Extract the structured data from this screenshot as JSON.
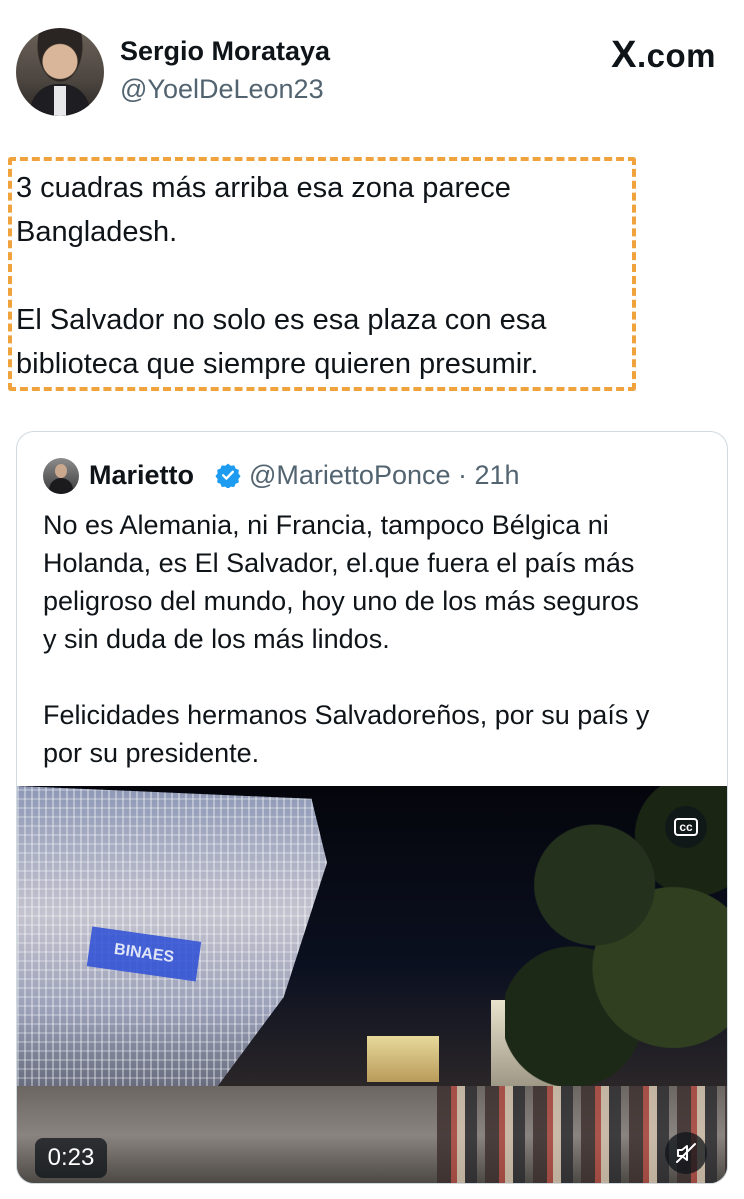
{
  "header": {
    "name": "Sergio Morataya",
    "handle": "@YoelDeLeon23",
    "site_logo": ".com",
    "site_logo_x": "X"
  },
  "tweet": {
    "text": "3 cuadras más arriba esa zona parece\nBangladesh.\n\nEl Salvador no solo es esa plaza con esa\nbiblioteca que siempre quieren presumir."
  },
  "quoted_tweet": {
    "name": "Marietto",
    "handle_time": "@MariettoPonce · 21h",
    "text": "No es Alemania, ni Francia, tampoco Bélgica ni\nHolanda, es El Salvador, el.que fuera el país más\npeligroso del mundo, hoy uno de los más seguros\ny sin duda de los más lindos.\n\nFelicidades hermanos Salvadoreños, por su país y\npor su presidente.",
    "verified_color": "#1d9bf0"
  },
  "video": {
    "duration": "0:23",
    "sign_text": "BINAES",
    "cc_label": "cc",
    "icons": [
      "closed-captions-icon",
      "muted-speaker-icon"
    ]
  },
  "colors": {
    "highlight_border": "#f0a23c",
    "text": "#0f1419",
    "secondary_text": "#536471"
  }
}
